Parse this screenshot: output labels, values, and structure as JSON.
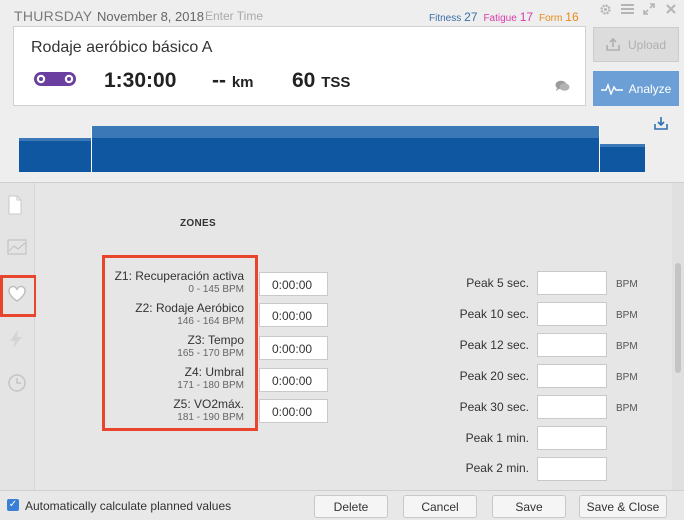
{
  "header": {
    "day": "THURSDAY",
    "date": "November 8, 2018",
    "enter_time_placeholder": "Enter Time",
    "fitness_label": "Fitness",
    "fitness_value": "27",
    "fatigue_label": "Fatigue",
    "fatigue_value": "17",
    "form_label": "Form",
    "form_value": "16"
  },
  "summary": {
    "title": "Rodaje aeróbico básico A",
    "duration": "1:30:00",
    "distance": "--",
    "distance_unit": "km",
    "tss": "60",
    "tss_unit": "TSS"
  },
  "actions": {
    "upload_label": "Upload",
    "analyze_label": "Analyze"
  },
  "chart_data": {
    "type": "bar",
    "description_segments": [
      {
        "label": "warmup",
        "duration_fraction": 0.124,
        "level": 0.55
      },
      {
        "label": "main",
        "duration_fraction": 0.876,
        "level": 0.6
      },
      {
        "label": "cooldown",
        "duration_fraction": 0.14,
        "level": 0.4
      }
    ]
  },
  "main": {
    "zones_title": "ZONES",
    "zones": [
      {
        "name": "Z1: Recuperación activa",
        "range": "0 - 145 BPM",
        "time": "0:00:00"
      },
      {
        "name": "Z2: Rodaje Aeróbico",
        "range": "146 - 164 BPM",
        "time": "0:00:00"
      },
      {
        "name": "Z3: Tempo",
        "range": "165 - 170 BPM",
        "time": "0:00:00"
      },
      {
        "name": "Z4: Umbral",
        "range": "171 - 180 BPM",
        "time": "0:00:00"
      },
      {
        "name": "Z5: VO2máx.",
        "range": "181 - 190 BPM",
        "time": "0:00:00"
      }
    ],
    "peaks": [
      {
        "label": "Peak 5 sec.",
        "unit": "BPM"
      },
      {
        "label": "Peak 10 sec.",
        "unit": "BPM"
      },
      {
        "label": "Peak 12 sec.",
        "unit": "BPM"
      },
      {
        "label": "Peak 20 sec.",
        "unit": "BPM"
      },
      {
        "label": "Peak 30 sec.",
        "unit": "BPM"
      },
      {
        "label": "Peak 1 min.",
        "unit": ""
      },
      {
        "label": "Peak 2 min.",
        "unit": ""
      }
    ]
  },
  "footer": {
    "auto_label": "Automatically calculate planned values",
    "delete_label": "Delete",
    "cancel_label": "Cancel",
    "save_label": "Save",
    "save_close_label": "Save & Close"
  },
  "colors": {
    "accent": "#6b9fd6",
    "highlight": "#e8452c",
    "fitness": "#3c6fa8",
    "fatigue": "#d63caa",
    "form": "#e88a1a",
    "chart_dark": "#0f57a0",
    "chart_light": "#3a78b8"
  }
}
